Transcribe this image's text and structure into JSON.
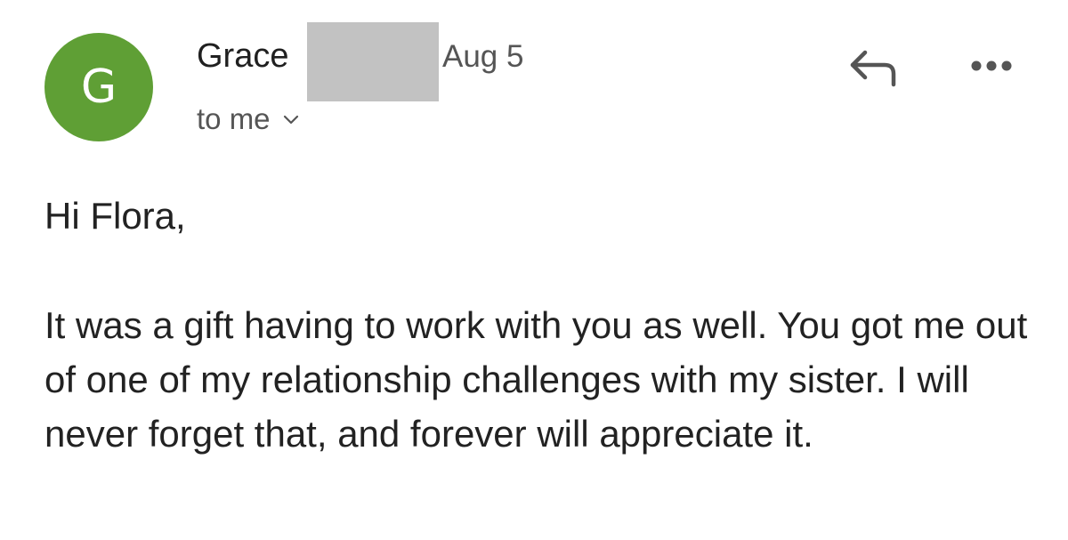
{
  "sender": {
    "avatar_letter": "G",
    "avatar_color": "#5f9f35",
    "name": "Grace",
    "date": "Aug 5",
    "recipient": "to me",
    "redaction_color": "#c2c2c2"
  },
  "actions": {
    "reply_icon": "reply-icon",
    "more_icon": "more-options-icon"
  },
  "message": {
    "greeting": "Hi Flora,",
    "body": "It was a gift having to work with you as well. You got me out of one of my relationship challenges with my sister. I will never forget that, and forever will appreciate it."
  }
}
